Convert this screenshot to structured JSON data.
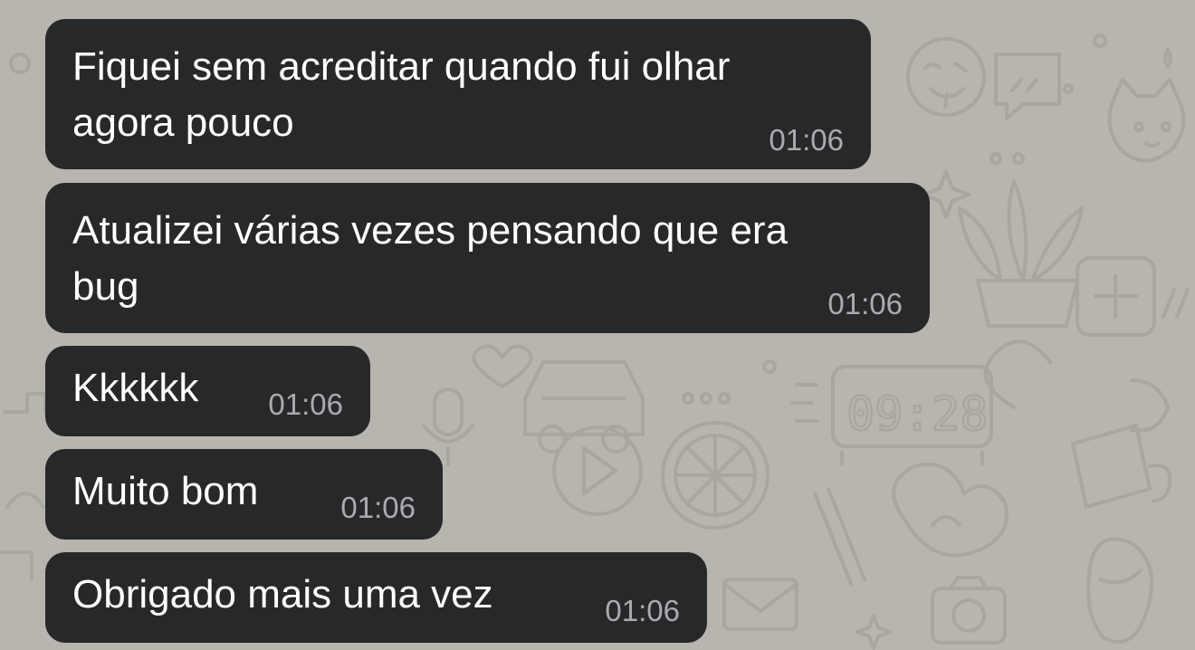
{
  "theme": {
    "wallpaper_color": "#b8b4ae",
    "doodle_color": "#a9a59f",
    "bubble_color": "#272829",
    "text_color": "#ffffff",
    "time_color": "#a9abae"
  },
  "wallpaper": {
    "clock_text": "09:28"
  },
  "messages": [
    {
      "text": "Fiquei sem acreditar quando fui olhar\nagora pouco",
      "time": "01:06"
    },
    {
      "text": "Atualizei várias vezes pensando que era\nbug",
      "time": "01:06"
    },
    {
      "text": "Kkkkkk",
      "time": "01:06"
    },
    {
      "text": "Muito bom",
      "time": "01:06"
    },
    {
      "text": "Obrigado mais uma vez",
      "time": "01:06"
    }
  ]
}
